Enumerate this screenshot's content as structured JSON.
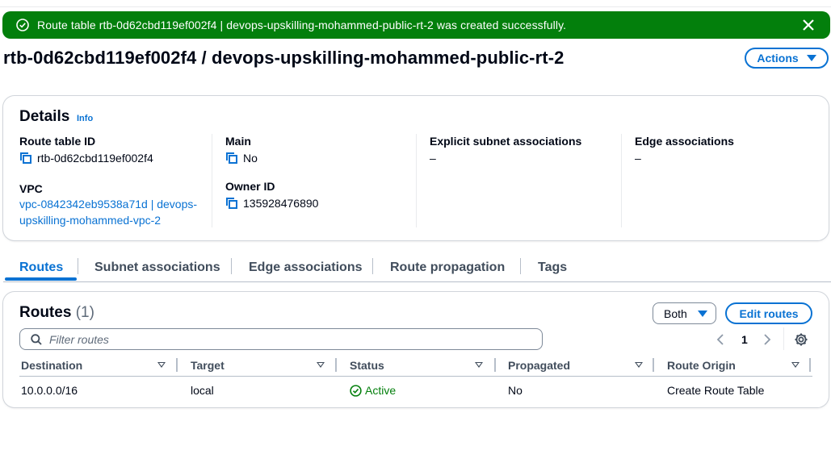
{
  "flash": {
    "message": "Route table rtb-0d62cbd119ef002f4 | devops-upskilling-mohammed-public-rt-2 was created successfully."
  },
  "header": {
    "title": "rtb-0d62cbd119ef002f4 / devops-upskilling-mohammed-public-rt-2",
    "actions_label": "Actions"
  },
  "details": {
    "heading": "Details",
    "info_label": "Info",
    "route_table_id_label": "Route table ID",
    "route_table_id": "rtb-0d62cbd119ef002f4",
    "main_label": "Main",
    "main_value": "No",
    "explicit_subnet_label": "Explicit subnet associations",
    "explicit_subnet_value": "–",
    "edge_label": "Edge associations",
    "edge_value": "–",
    "vpc_label": "VPC",
    "vpc_line1": "vpc-0842342eb9538a71d | devops-",
    "vpc_line2": "upskilling-mohammed-vpc-2",
    "owner_label": "Owner ID",
    "owner_value": "135928476890"
  },
  "tabs": [
    {
      "label": "Routes",
      "active": true
    },
    {
      "label": "Subnet associations",
      "active": false
    },
    {
      "label": "Edge associations",
      "active": false
    },
    {
      "label": "Route propagation",
      "active": false
    },
    {
      "label": "Tags",
      "active": false
    }
  ],
  "routes": {
    "heading": "Routes",
    "count": "(1)",
    "filter_select": "Both",
    "edit_label": "Edit routes",
    "filter_placeholder": "Filter routes",
    "page": "1",
    "columns": [
      "Destination",
      "Target",
      "Status",
      "Propagated",
      "Route Origin"
    ],
    "rows": [
      {
        "destination": "10.0.0.0/16",
        "target": "local",
        "status": "Active",
        "propagated": "No",
        "origin": "Create Route Table"
      }
    ]
  },
  "colors": {
    "success": "#037f0c",
    "link": "#0972d3",
    "text": "#000716"
  }
}
